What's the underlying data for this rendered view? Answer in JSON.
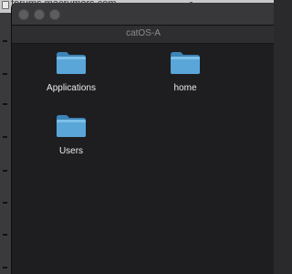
{
  "background_browser": {
    "tab_title": "forums.macrumors.com"
  },
  "finder_window": {
    "title": "catOS-A",
    "items": [
      {
        "label": "Applications",
        "icon": "folder-icon"
      },
      {
        "label": "home",
        "icon": "folder-icon"
      },
      {
        "label": "Users",
        "icon": "folder-icon"
      }
    ]
  },
  "colors": {
    "window_background": "#1e1e20",
    "titlebar": "#38383a",
    "folder_blue": "#5aa6d8",
    "label_text": "#ececec"
  }
}
